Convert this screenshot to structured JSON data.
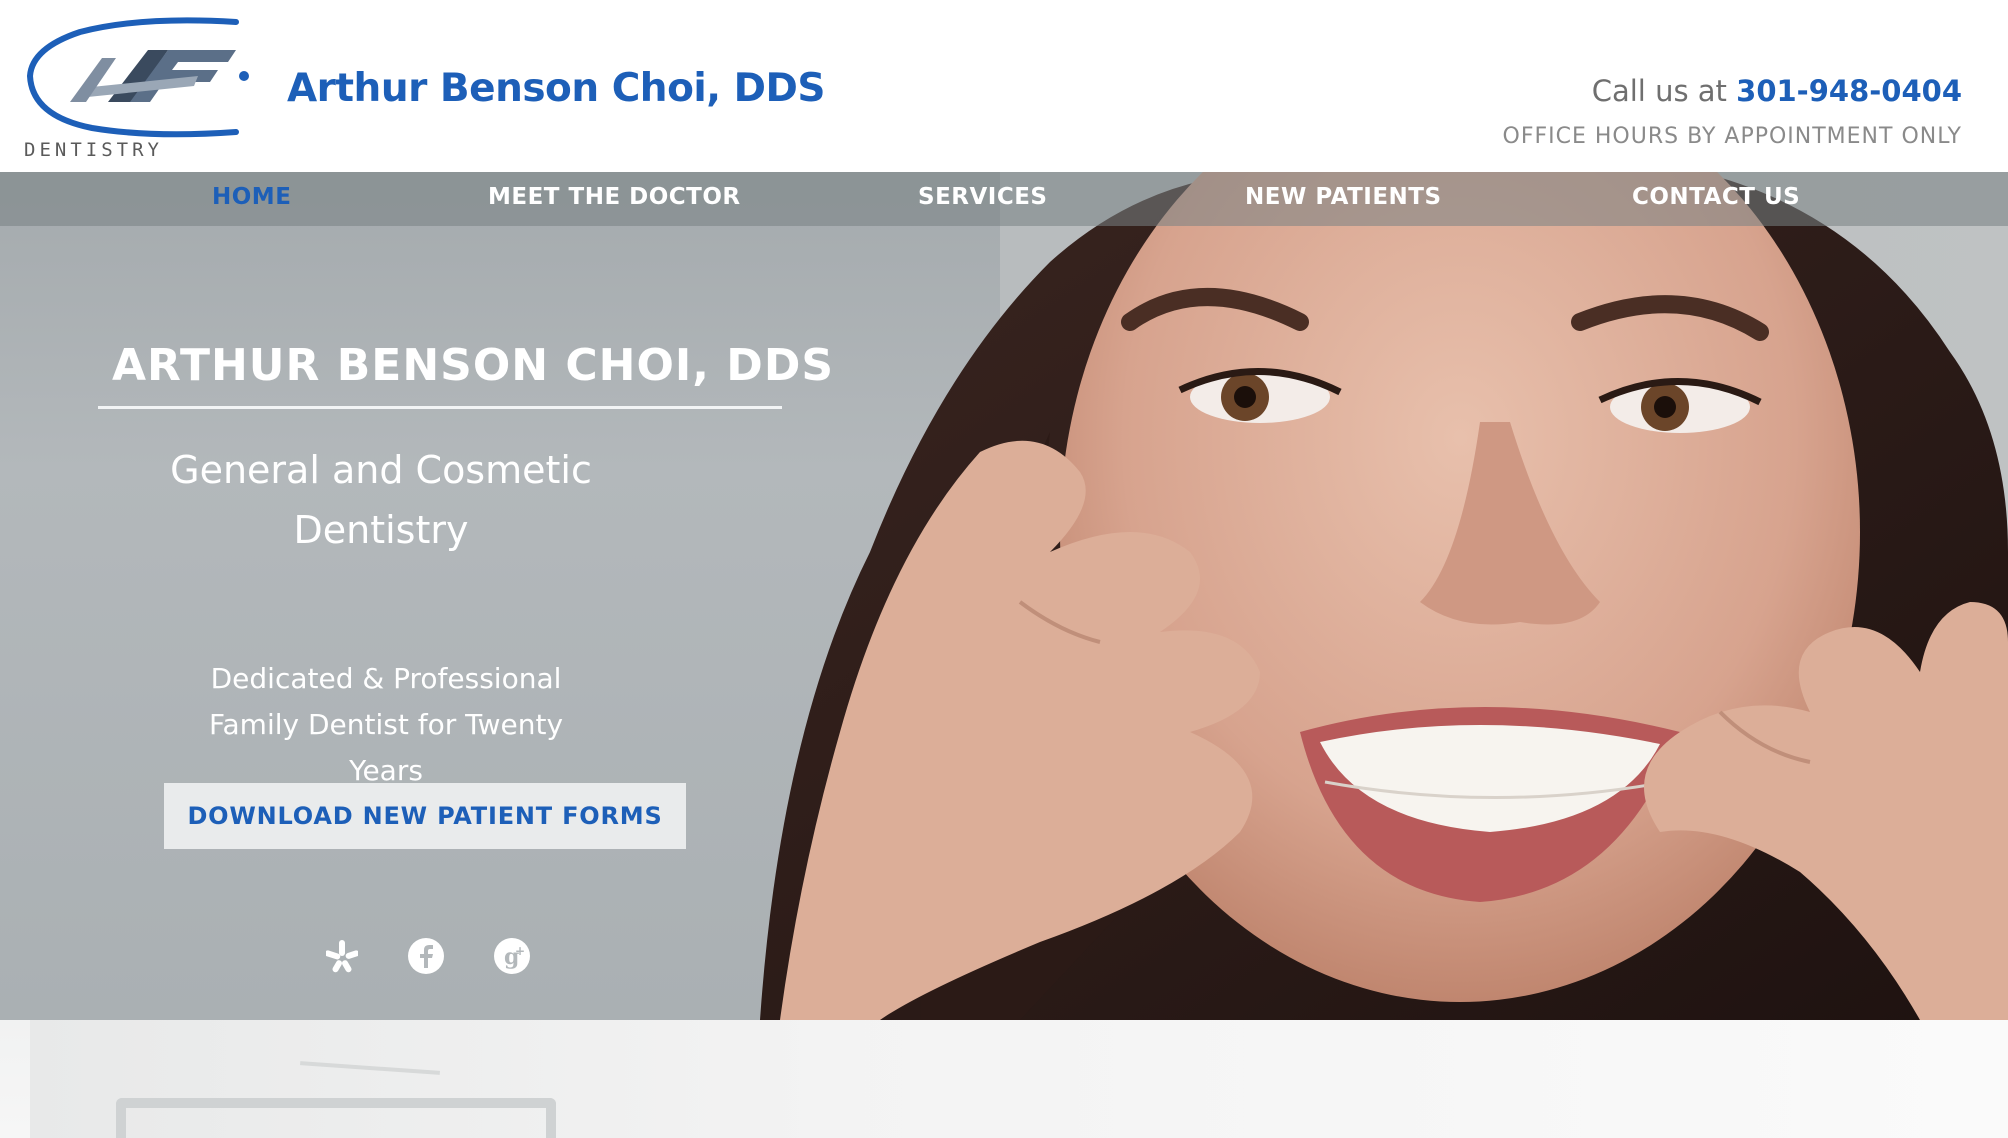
{
  "header": {
    "logo_text": "DENTISTRY",
    "brand_name": "Arthur Benson Choi, DDS",
    "call_label": "Call us at",
    "phone": "301-948-0404",
    "hours": "OFFICE HOURS BY APPOINTMENT ONLY"
  },
  "nav": {
    "items": [
      {
        "label": "HOME",
        "active": true
      },
      {
        "label": "MEET THE DOCTOR",
        "active": false
      },
      {
        "label": "SERVICES",
        "active": false
      },
      {
        "label": "NEW PATIENTS",
        "active": false
      },
      {
        "label": "CONTACT US",
        "active": false
      }
    ]
  },
  "hero": {
    "title": "ARTHUR BENSON CHOI, DDS",
    "subtitle": "General and Cosmetic Dentistry",
    "description": "Dedicated & Professional Family Dentist for Twenty Years",
    "button_label": "DOWNLOAD NEW PATIENT FORMS",
    "social": [
      {
        "icon": "yelp-icon"
      },
      {
        "icon": "facebook-icon"
      },
      {
        "icon": "google-plus-icon"
      }
    ]
  },
  "colors": {
    "brand_blue": "#1d5fb8",
    "hero_gray": "#b3b8bb",
    "button_bg": "#e9ebec"
  }
}
